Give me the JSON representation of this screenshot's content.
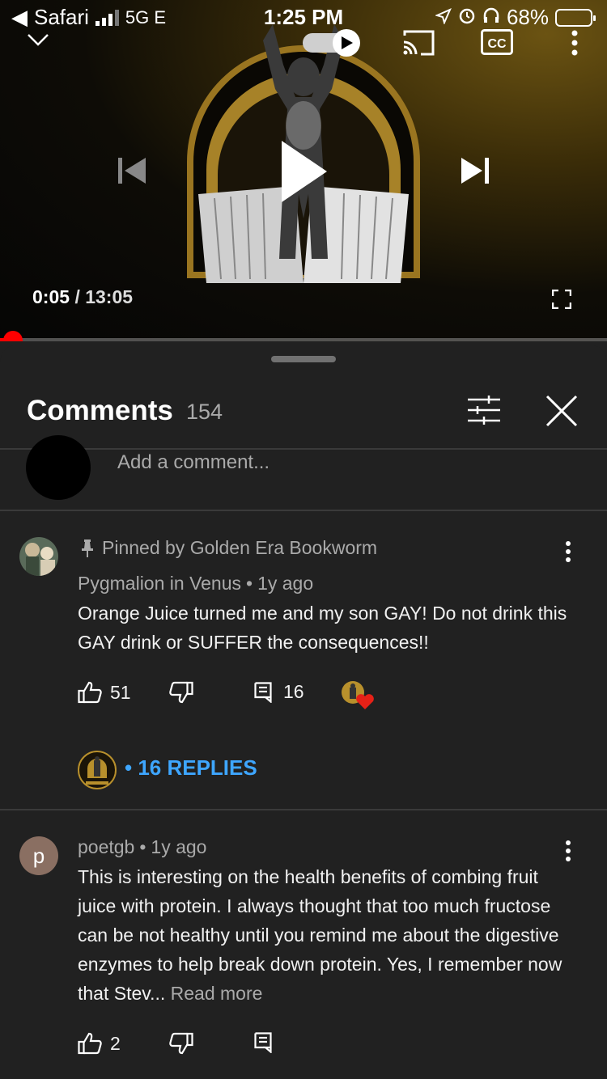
{
  "status_bar": {
    "back_app": "Safari",
    "network": "5G E",
    "time": "1:25 PM",
    "battery_percent": "68%",
    "battery_level": 0.68
  },
  "player": {
    "current_time": "0:05",
    "separator": "/",
    "duration": "13:05",
    "progress_fraction": 0.0064,
    "accent_color": "#ff0000",
    "cc_label": "CC"
  },
  "comments_panel": {
    "title": "Comments",
    "count": "154",
    "add_placeholder": "Add a comment..."
  },
  "comments": [
    {
      "pinned_label": "Pinned by Golden Era Bookworm",
      "author": "Pygmalion in Venus",
      "dot": "•",
      "age": "1y ago",
      "text": "Orange Juice turned me and my son GAY! Do not drink this GAY drink or SUFFER the consequences!!",
      "likes": "51",
      "replies_count": "16",
      "replies_link": "• 16 REPLIES"
    },
    {
      "avatar_letter": "p",
      "author": "poetgb",
      "dot": "•",
      "age": "1y ago",
      "text": "This is interesting on the health benefits of combing fruit juice with protein.  I always thought that too much fructose can be not healthy until you remind me about the digestive enzymes to help break down protein. Yes, I remember now that Stev...",
      "read_more": "Read more",
      "likes": "2"
    }
  ],
  "icons": {
    "collapse": "chevron-down-icon",
    "autoplay": "autoplay-toggle-icon",
    "cast": "cast-icon",
    "captions": "captions-icon",
    "more": "more-vert-icon",
    "previous": "skip-previous-icon",
    "play": "play-icon",
    "next": "skip-next-icon",
    "fullscreen": "fullscreen-icon",
    "filter": "sort-filter-icon",
    "close": "close-icon",
    "pin": "pin-icon",
    "like": "thumb-up-icon",
    "dislike": "thumb-down-icon",
    "reply": "reply-icon",
    "heart": "heart-icon"
  },
  "colors": {
    "sheet_bg": "#212121",
    "link_blue": "#3ea6ff",
    "heart_red": "#e62117",
    "gold": "#c19a3a"
  }
}
